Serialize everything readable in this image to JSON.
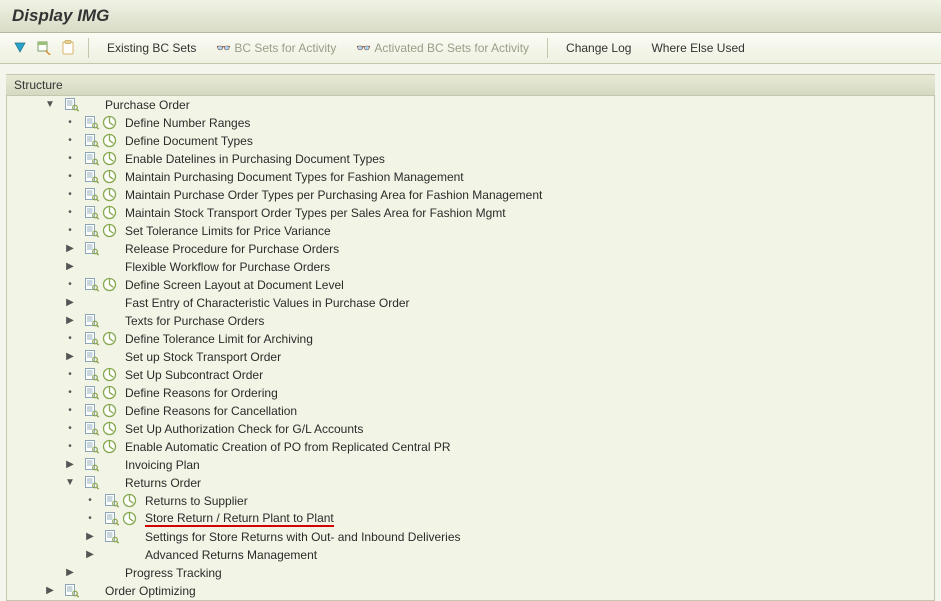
{
  "title": "Display IMG",
  "toolbar": {
    "existing_bc_sets": "Existing BC Sets",
    "bc_sets_for_activity": "BC Sets for Activity",
    "activated_bc_sets": "Activated BC Sets for Activity",
    "change_log": "Change Log",
    "where_else_used": "Where Else Used"
  },
  "structure_label": "Structure",
  "nodes": [
    {
      "depth": 0,
      "exp": "open",
      "doc": true,
      "act": false,
      "label": "Purchase Order"
    },
    {
      "depth": 1,
      "exp": "leaf",
      "doc": true,
      "act": true,
      "label": "Define Number Ranges"
    },
    {
      "depth": 1,
      "exp": "leaf",
      "doc": true,
      "act": true,
      "label": "Define Document Types"
    },
    {
      "depth": 1,
      "exp": "leaf",
      "doc": true,
      "act": true,
      "label": "Enable Datelines in Purchasing Document Types"
    },
    {
      "depth": 1,
      "exp": "leaf",
      "doc": true,
      "act": true,
      "label": "Maintain Purchasing Document Types for Fashion Management"
    },
    {
      "depth": 1,
      "exp": "leaf",
      "doc": true,
      "act": true,
      "label": "Maintain Purchase Order Types per Purchasing Area for Fashion Management"
    },
    {
      "depth": 1,
      "exp": "leaf",
      "doc": true,
      "act": true,
      "label": "Maintain Stock Transport Order Types per Sales Area for Fashion Mgmt"
    },
    {
      "depth": 1,
      "exp": "leaf",
      "doc": true,
      "act": true,
      "label": "Set Tolerance Limits for Price Variance"
    },
    {
      "depth": 1,
      "exp": "closed",
      "doc": true,
      "act": false,
      "label": "Release Procedure for Purchase Orders"
    },
    {
      "depth": 1,
      "exp": "closed",
      "doc": false,
      "act": false,
      "label": "Flexible Workflow for Purchase Orders"
    },
    {
      "depth": 1,
      "exp": "leaf",
      "doc": true,
      "act": true,
      "label": "Define Screen Layout at Document Level"
    },
    {
      "depth": 1,
      "exp": "closed",
      "doc": false,
      "act": false,
      "label": "Fast Entry of Characteristic Values in Purchase Order"
    },
    {
      "depth": 1,
      "exp": "closed",
      "doc": true,
      "act": false,
      "label": "Texts for Purchase Orders"
    },
    {
      "depth": 1,
      "exp": "leaf",
      "doc": true,
      "act": true,
      "label": "Define Tolerance Limit for Archiving"
    },
    {
      "depth": 1,
      "exp": "closed",
      "doc": true,
      "act": false,
      "label": "Set up Stock Transport Order"
    },
    {
      "depth": 1,
      "exp": "leaf",
      "doc": true,
      "act": true,
      "label": "Set Up Subcontract Order"
    },
    {
      "depth": 1,
      "exp": "leaf",
      "doc": true,
      "act": true,
      "label": "Define Reasons for Ordering"
    },
    {
      "depth": 1,
      "exp": "leaf",
      "doc": true,
      "act": true,
      "label": "Define Reasons for Cancellation"
    },
    {
      "depth": 1,
      "exp": "leaf",
      "doc": true,
      "act": true,
      "label": "Set Up Authorization Check for G/L Accounts"
    },
    {
      "depth": 1,
      "exp": "leaf",
      "doc": true,
      "act": true,
      "label": "Enable Automatic Creation of PO from Replicated Central PR"
    },
    {
      "depth": 1,
      "exp": "closed",
      "doc": true,
      "act": false,
      "label": "Invoicing Plan"
    },
    {
      "depth": 1,
      "exp": "open",
      "doc": true,
      "act": false,
      "label": "Returns Order"
    },
    {
      "depth": 2,
      "exp": "leaf",
      "doc": true,
      "act": true,
      "label": "Returns to Supplier"
    },
    {
      "depth": 2,
      "exp": "leaf",
      "doc": true,
      "act": true,
      "label": "Store Return / Return Plant to Plant",
      "hl": true
    },
    {
      "depth": 2,
      "exp": "closed",
      "doc": true,
      "act": false,
      "label": "Settings for Store Returns with Out- and Inbound Deliveries"
    },
    {
      "depth": 2,
      "exp": "closed",
      "doc": false,
      "act": false,
      "label": "Advanced Returns Management"
    },
    {
      "depth": 1,
      "exp": "closed",
      "doc": false,
      "act": false,
      "label": "Progress Tracking"
    },
    {
      "depth": 0,
      "exp": "closed",
      "doc": true,
      "act": false,
      "label": "Order Optimizing"
    }
  ]
}
